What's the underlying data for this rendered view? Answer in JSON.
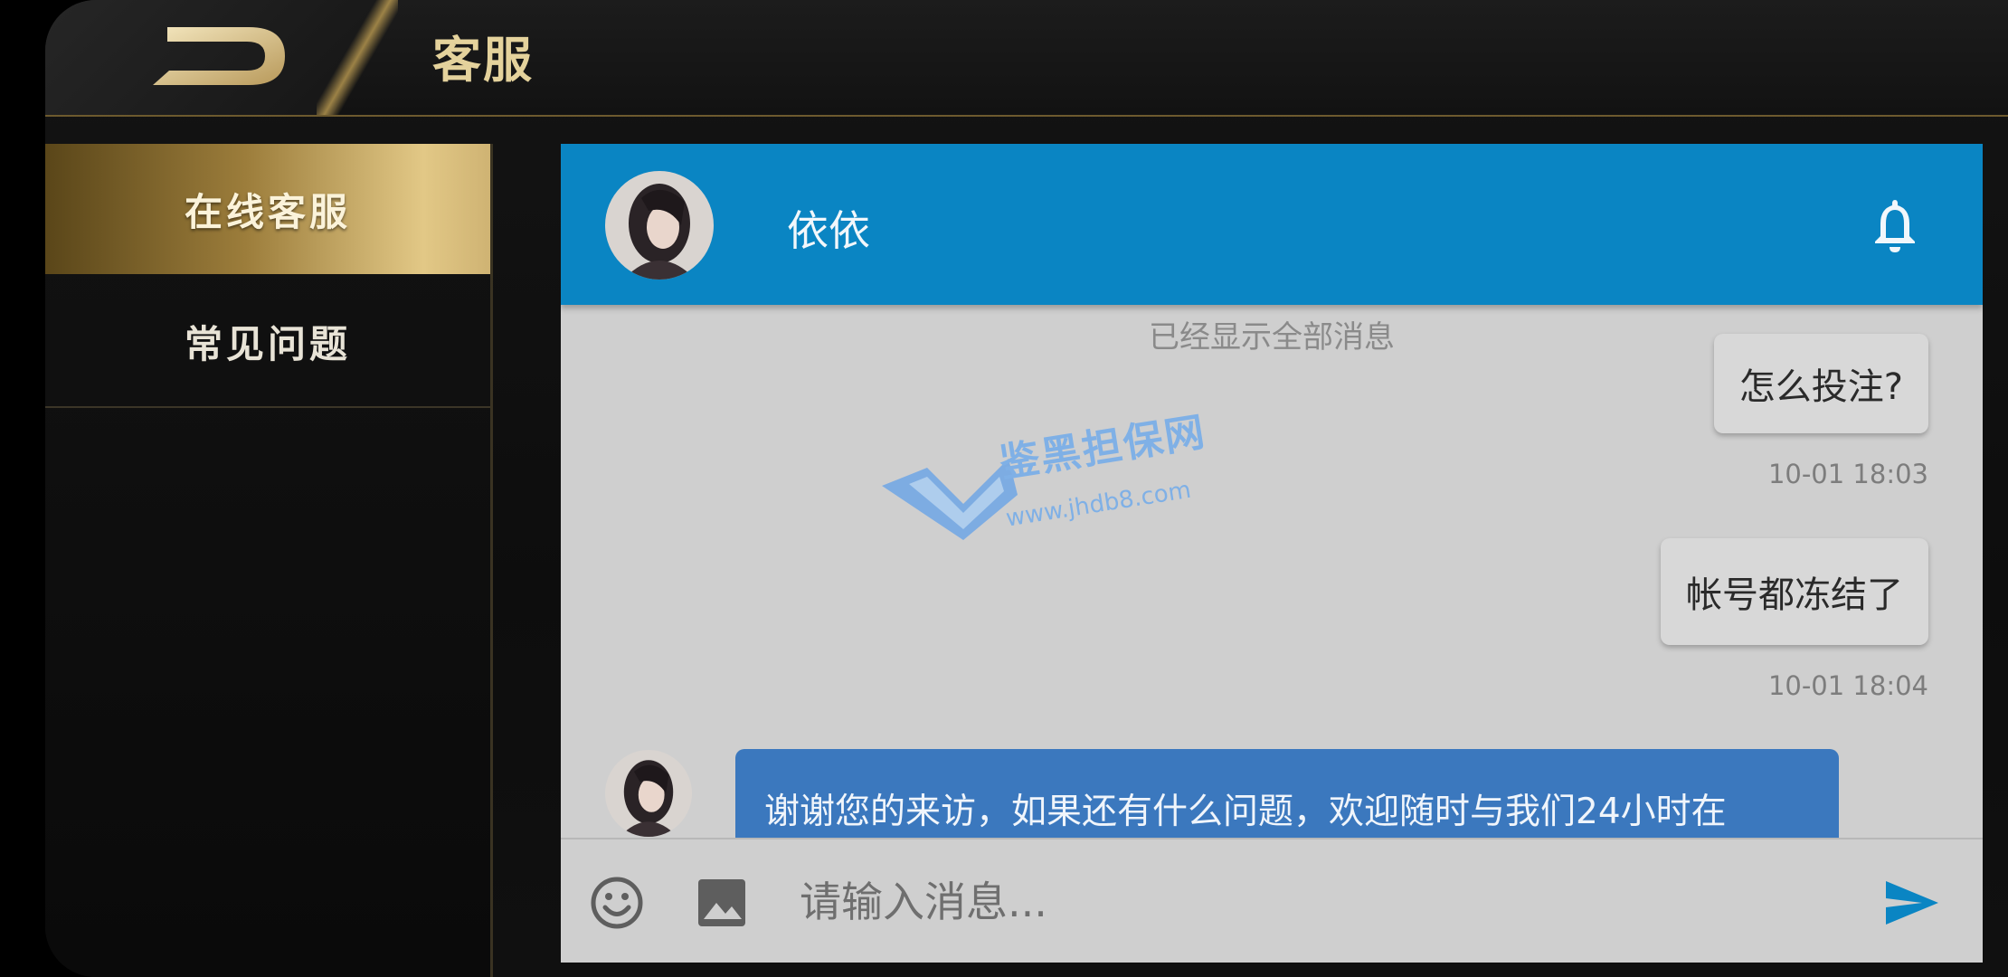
{
  "header": {
    "title": "客服",
    "back_icon": "back-logo-icon"
  },
  "sidebar": {
    "items": [
      {
        "label": "在线客服",
        "active": true
      },
      {
        "label": "常见问题",
        "active": false
      }
    ]
  },
  "chat": {
    "agent_name": "依依",
    "history_note": "已经显示全部消息",
    "messages": [
      {
        "from": "user",
        "text": "怎么投注?",
        "time": "10-01 18:03"
      },
      {
        "from": "user",
        "text": "帐号都冻结了",
        "time": "10-01 18:04"
      },
      {
        "from": "agent",
        "text": "谢谢您的来访，如果还有什么问题，欢迎随时与我们24小时在"
      }
    ],
    "input_placeholder": "请输入消息...",
    "icons": {
      "bell": "bell-icon",
      "emoji": "emoji-icon",
      "image": "image-icon",
      "send": "send-icon"
    }
  },
  "watermark": {
    "title": "鉴黑担保网",
    "url": "www.jhdb8.com"
  },
  "colors": {
    "chat_header": "#0a85c3",
    "agent_bubble": "#3b78be",
    "gold": "#e4d29c"
  }
}
